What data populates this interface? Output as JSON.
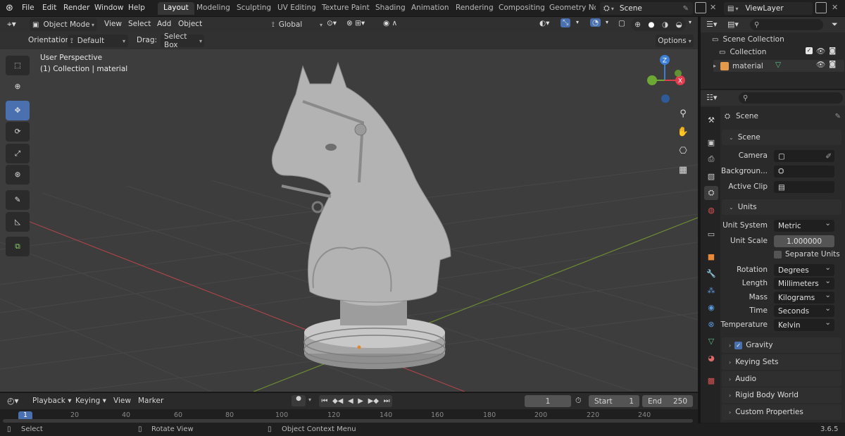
{
  "topbar": {
    "menus": [
      "File",
      "Edit",
      "Render",
      "Window",
      "Help"
    ],
    "workspaces": [
      "Layout",
      "Modeling",
      "Sculpting",
      "UV Editing",
      "Texture Paint",
      "Shading",
      "Animation",
      "Rendering",
      "Compositing",
      "Geometry Noc"
    ],
    "active_workspace": "Layout",
    "scene_name": "Scene",
    "view_layer": "ViewLayer"
  },
  "viewport": {
    "mode": "Object Mode",
    "menus": [
      "View",
      "Select",
      "Add",
      "Object"
    ],
    "transform_orientation": "Global",
    "orientation_label": "Orientation:",
    "orientation_value": "Default",
    "drag_label": "Drag:",
    "drag_value": "Select Box",
    "options_label": "Options",
    "overlay_line1": "User Perspective",
    "overlay_line2": "(1) Collection | material",
    "gizmo_axes": {
      "x": "X",
      "y": "Y",
      "z": "Z"
    }
  },
  "outliner": {
    "root": "Scene Collection",
    "items": [
      {
        "label": "Collection"
      },
      {
        "label": "material"
      }
    ]
  },
  "properties": {
    "header": "Scene",
    "panel_scene": "Scene",
    "camera_label": "Camera",
    "background_label": "Backgroun...",
    "active_clip_label": "Active Clip",
    "panel_units": "Units",
    "unit_system_label": "Unit System",
    "unit_system": "Metric",
    "unit_scale_label": "Unit Scale",
    "unit_scale": "1.000000",
    "separate_units": "Separate Units",
    "rotation_label": "Rotation",
    "rotation": "Degrees",
    "length_label": "Length",
    "length": "Millimeters",
    "mass_label": "Mass",
    "mass": "Kilograms",
    "time_label": "Time",
    "time": "Seconds",
    "temperature_label": "Temperature",
    "temperature": "Kelvin",
    "collapsed_panels": [
      "Gravity",
      "Keying Sets",
      "Audio",
      "Rigid Body World",
      "Custom Properties"
    ]
  },
  "timeline": {
    "menus": [
      "Playback",
      "Keying",
      "View",
      "Marker"
    ],
    "current_frame": "1",
    "start_label": "Start",
    "start": "1",
    "end_label": "End",
    "end": "250",
    "ruler": [
      "1",
      "20",
      "40",
      "60",
      "80",
      "100",
      "120",
      "140",
      "160",
      "180",
      "200",
      "220",
      "240"
    ]
  },
  "statusbar": {
    "select": "Select",
    "rotate": "Rotate View",
    "context": "Object Context Menu",
    "version": "3.6.5"
  },
  "colors": {
    "accent": "#4a70b0",
    "x_axis": "#e03c4b",
    "y_axis": "#6ca833",
    "z_axis": "#3d7fd6"
  }
}
